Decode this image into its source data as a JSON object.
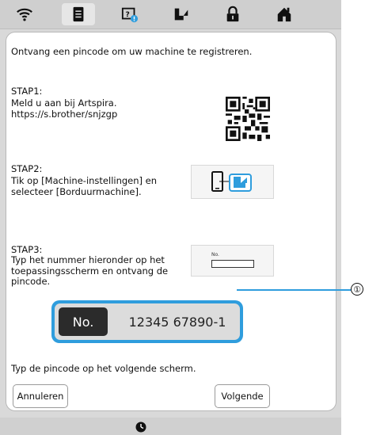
{
  "tabs": [
    {
      "icon": "wifi-icon"
    },
    {
      "icon": "document-icon",
      "active": true
    },
    {
      "icon": "help-notification-icon"
    },
    {
      "icon": "sewing-machine-icon"
    },
    {
      "icon": "lock-icon"
    },
    {
      "icon": "home-icon"
    }
  ],
  "intro": "Ontvang een pincode om uw machine te registreren.",
  "step1": {
    "title": "STAP1:",
    "text": "Meld u aan bij Artspira.\nhttps://s.brother/snjzgp"
  },
  "step2": {
    "title": "STAP2:",
    "text": "Tik op [Machine-instellingen] en\nselecteer [Borduurmachine]."
  },
  "step3": {
    "title": "STAP3:",
    "text": "Typ het nummer hieronder op het\ntoepassingsscherm en ontvang de\npincode.",
    "mini_label": "No."
  },
  "pin": {
    "label": "No.",
    "value": "12345 67890-1"
  },
  "footer_text": "Typ de pincode op het volgende scherm.",
  "buttons": {
    "cancel": "Annuleren",
    "next": "Volgende"
  },
  "callout": "①",
  "colors": {
    "accent": "#2f9ddd",
    "pin_label_bg": "#2b2b2b"
  }
}
